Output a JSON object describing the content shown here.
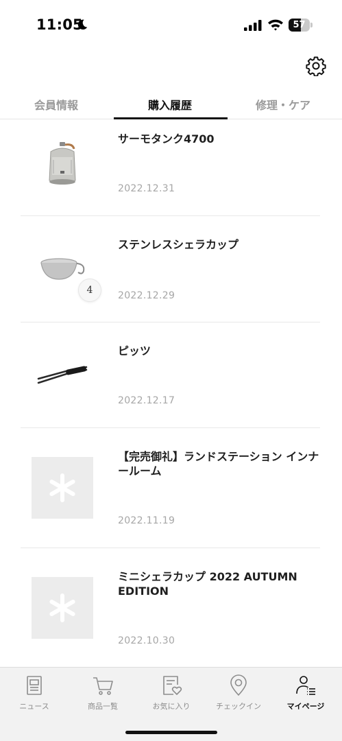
{
  "status_bar": {
    "time": "11:05",
    "battery_level": "57",
    "battery_fraction": 0.57
  },
  "header": {
    "settings_icon": "gear-icon"
  },
  "tabs": [
    {
      "label": "会員情報",
      "active": false
    },
    {
      "label": "購入履歴",
      "active": true
    },
    {
      "label": "修理・ケア",
      "active": false
    }
  ],
  "purchases": [
    {
      "title": "サーモタンク4700",
      "date": "2022.12.31",
      "image": "thermo-tank"
    },
    {
      "title": "ステンレスシェラカップ",
      "date": "2022.12.29",
      "image": "sierra-cup",
      "quantity": "4"
    },
    {
      "title": "ピッツ",
      "date": "2022.12.17",
      "image": "tongs"
    },
    {
      "title": "【完売御礼】ランドステーション インナールーム",
      "date": "2022.11.19",
      "image": "placeholder"
    },
    {
      "title": "ミニシェラカップ 2022 AUTUMN EDITION",
      "date": "2022.10.30",
      "image": "placeholder"
    }
  ],
  "tabbar": [
    {
      "label": "ニュース",
      "icon": "news-icon",
      "active": false
    },
    {
      "label": "商品一覧",
      "icon": "cart-icon",
      "active": false
    },
    {
      "label": "お気に入り",
      "icon": "favorite-icon",
      "active": false
    },
    {
      "label": "チェックイン",
      "icon": "location-pin-icon",
      "active": false
    },
    {
      "label": "マイページ",
      "icon": "user-list-icon",
      "active": true
    }
  ],
  "colors": {
    "active_text": "#111111",
    "inactive_text": "#9a9a9a",
    "placeholder_bg": "#ececec",
    "tabbar_bg": "#f2f2f2"
  }
}
